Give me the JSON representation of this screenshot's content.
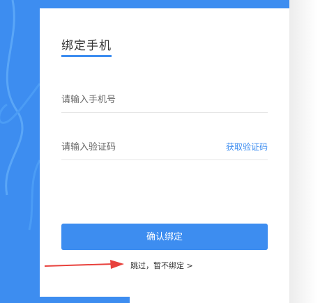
{
  "bind_phone": {
    "title": "绑定手机",
    "phone_placeholder": "请输入手机号",
    "code_placeholder": "请输入验证码",
    "get_code_label": "获取验证码",
    "confirm_label": "确认绑定",
    "skip_label": "跳过，暂不绑定 >"
  },
  "colors": {
    "accent": "#3d8df0",
    "annotation_arrow": "#e8413c"
  }
}
